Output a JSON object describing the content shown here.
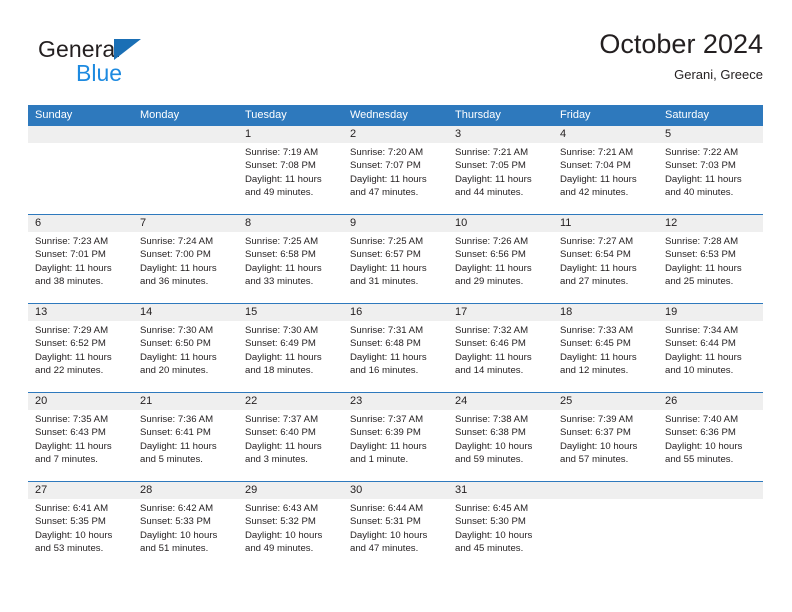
{
  "brand": {
    "word_one": "General",
    "word_two": "Blue",
    "triangle_icon": "triangle-icon",
    "accent_dark": "#1a6fb5",
    "accent_light": "#1d8ae0"
  },
  "header": {
    "title": "October 2024",
    "subtitle": "Gerani, Greece"
  },
  "colors": {
    "header_blue": "#2e79bd",
    "date_band_gray": "#efefef",
    "text": "#231f20"
  },
  "calendar": {
    "weekdays": [
      "Sunday",
      "Monday",
      "Tuesday",
      "Wednesday",
      "Thursday",
      "Friday",
      "Saturday"
    ],
    "labels": {
      "sunrise": "Sunrise:",
      "sunset": "Sunset:",
      "daylight": "Daylight:"
    },
    "weeks": [
      [
        {
          "day": "",
          "empty": true
        },
        {
          "day": "",
          "empty": true
        },
        {
          "day": "1",
          "sunrise": "Sunrise: 7:19 AM",
          "sunset": "Sunset: 7:08 PM",
          "daylight_line1": "Daylight: 11 hours",
          "daylight_line2": "and 49 minutes."
        },
        {
          "day": "2",
          "sunrise": "Sunrise: 7:20 AM",
          "sunset": "Sunset: 7:07 PM",
          "daylight_line1": "Daylight: 11 hours",
          "daylight_line2": "and 47 minutes."
        },
        {
          "day": "3",
          "sunrise": "Sunrise: 7:21 AM",
          "sunset": "Sunset: 7:05 PM",
          "daylight_line1": "Daylight: 11 hours",
          "daylight_line2": "and 44 minutes."
        },
        {
          "day": "4",
          "sunrise": "Sunrise: 7:21 AM",
          "sunset": "Sunset: 7:04 PM",
          "daylight_line1": "Daylight: 11 hours",
          "daylight_line2": "and 42 minutes."
        },
        {
          "day": "5",
          "sunrise": "Sunrise: 7:22 AM",
          "sunset": "Sunset: 7:03 PM",
          "daylight_line1": "Daylight: 11 hours",
          "daylight_line2": "and 40 minutes."
        }
      ],
      [
        {
          "day": "6",
          "sunrise": "Sunrise: 7:23 AM",
          "sunset": "Sunset: 7:01 PM",
          "daylight_line1": "Daylight: 11 hours",
          "daylight_line2": "and 38 minutes."
        },
        {
          "day": "7",
          "sunrise": "Sunrise: 7:24 AM",
          "sunset": "Sunset: 7:00 PM",
          "daylight_line1": "Daylight: 11 hours",
          "daylight_line2": "and 36 minutes."
        },
        {
          "day": "8",
          "sunrise": "Sunrise: 7:25 AM",
          "sunset": "Sunset: 6:58 PM",
          "daylight_line1": "Daylight: 11 hours",
          "daylight_line2": "and 33 minutes."
        },
        {
          "day": "9",
          "sunrise": "Sunrise: 7:25 AM",
          "sunset": "Sunset: 6:57 PM",
          "daylight_line1": "Daylight: 11 hours",
          "daylight_line2": "and 31 minutes."
        },
        {
          "day": "10",
          "sunrise": "Sunrise: 7:26 AM",
          "sunset": "Sunset: 6:56 PM",
          "daylight_line1": "Daylight: 11 hours",
          "daylight_line2": "and 29 minutes."
        },
        {
          "day": "11",
          "sunrise": "Sunrise: 7:27 AM",
          "sunset": "Sunset: 6:54 PM",
          "daylight_line1": "Daylight: 11 hours",
          "daylight_line2": "and 27 minutes."
        },
        {
          "day": "12",
          "sunrise": "Sunrise: 7:28 AM",
          "sunset": "Sunset: 6:53 PM",
          "daylight_line1": "Daylight: 11 hours",
          "daylight_line2": "and 25 minutes."
        }
      ],
      [
        {
          "day": "13",
          "sunrise": "Sunrise: 7:29 AM",
          "sunset": "Sunset: 6:52 PM",
          "daylight_line1": "Daylight: 11 hours",
          "daylight_line2": "and 22 minutes."
        },
        {
          "day": "14",
          "sunrise": "Sunrise: 7:30 AM",
          "sunset": "Sunset: 6:50 PM",
          "daylight_line1": "Daylight: 11 hours",
          "daylight_line2": "and 20 minutes."
        },
        {
          "day": "15",
          "sunrise": "Sunrise: 7:30 AM",
          "sunset": "Sunset: 6:49 PM",
          "daylight_line1": "Daylight: 11 hours",
          "daylight_line2": "and 18 minutes."
        },
        {
          "day": "16",
          "sunrise": "Sunrise: 7:31 AM",
          "sunset": "Sunset: 6:48 PM",
          "daylight_line1": "Daylight: 11 hours",
          "daylight_line2": "and 16 minutes."
        },
        {
          "day": "17",
          "sunrise": "Sunrise: 7:32 AM",
          "sunset": "Sunset: 6:46 PM",
          "daylight_line1": "Daylight: 11 hours",
          "daylight_line2": "and 14 minutes."
        },
        {
          "day": "18",
          "sunrise": "Sunrise: 7:33 AM",
          "sunset": "Sunset: 6:45 PM",
          "daylight_line1": "Daylight: 11 hours",
          "daylight_line2": "and 12 minutes."
        },
        {
          "day": "19",
          "sunrise": "Sunrise: 7:34 AM",
          "sunset": "Sunset: 6:44 PM",
          "daylight_line1": "Daylight: 11 hours",
          "daylight_line2": "and 10 minutes."
        }
      ],
      [
        {
          "day": "20",
          "sunrise": "Sunrise: 7:35 AM",
          "sunset": "Sunset: 6:43 PM",
          "daylight_line1": "Daylight: 11 hours",
          "daylight_line2": "and 7 minutes."
        },
        {
          "day": "21",
          "sunrise": "Sunrise: 7:36 AM",
          "sunset": "Sunset: 6:41 PM",
          "daylight_line1": "Daylight: 11 hours",
          "daylight_line2": "and 5 minutes."
        },
        {
          "day": "22",
          "sunrise": "Sunrise: 7:37 AM",
          "sunset": "Sunset: 6:40 PM",
          "daylight_line1": "Daylight: 11 hours",
          "daylight_line2": "and 3 minutes."
        },
        {
          "day": "23",
          "sunrise": "Sunrise: 7:37 AM",
          "sunset": "Sunset: 6:39 PM",
          "daylight_line1": "Daylight: 11 hours",
          "daylight_line2": "and 1 minute."
        },
        {
          "day": "24",
          "sunrise": "Sunrise: 7:38 AM",
          "sunset": "Sunset: 6:38 PM",
          "daylight_line1": "Daylight: 10 hours",
          "daylight_line2": "and 59 minutes."
        },
        {
          "day": "25",
          "sunrise": "Sunrise: 7:39 AM",
          "sunset": "Sunset: 6:37 PM",
          "daylight_line1": "Daylight: 10 hours",
          "daylight_line2": "and 57 minutes."
        },
        {
          "day": "26",
          "sunrise": "Sunrise: 7:40 AM",
          "sunset": "Sunset: 6:36 PM",
          "daylight_line1": "Daylight: 10 hours",
          "daylight_line2": "and 55 minutes."
        }
      ],
      [
        {
          "day": "27",
          "sunrise": "Sunrise: 6:41 AM",
          "sunset": "Sunset: 5:35 PM",
          "daylight_line1": "Daylight: 10 hours",
          "daylight_line2": "and 53 minutes."
        },
        {
          "day": "28",
          "sunrise": "Sunrise: 6:42 AM",
          "sunset": "Sunset: 5:33 PM",
          "daylight_line1": "Daylight: 10 hours",
          "daylight_line2": "and 51 minutes."
        },
        {
          "day": "29",
          "sunrise": "Sunrise: 6:43 AM",
          "sunset": "Sunset: 5:32 PM",
          "daylight_line1": "Daylight: 10 hours",
          "daylight_line2": "and 49 minutes."
        },
        {
          "day": "30",
          "sunrise": "Sunrise: 6:44 AM",
          "sunset": "Sunset: 5:31 PM",
          "daylight_line1": "Daylight: 10 hours",
          "daylight_line2": "and 47 minutes."
        },
        {
          "day": "31",
          "sunrise": "Sunrise: 6:45 AM",
          "sunset": "Sunset: 5:30 PM",
          "daylight_line1": "Daylight: 10 hours",
          "daylight_line2": "and 45 minutes."
        },
        {
          "day": "",
          "empty": true
        },
        {
          "day": "",
          "empty": true
        }
      ]
    ]
  }
}
